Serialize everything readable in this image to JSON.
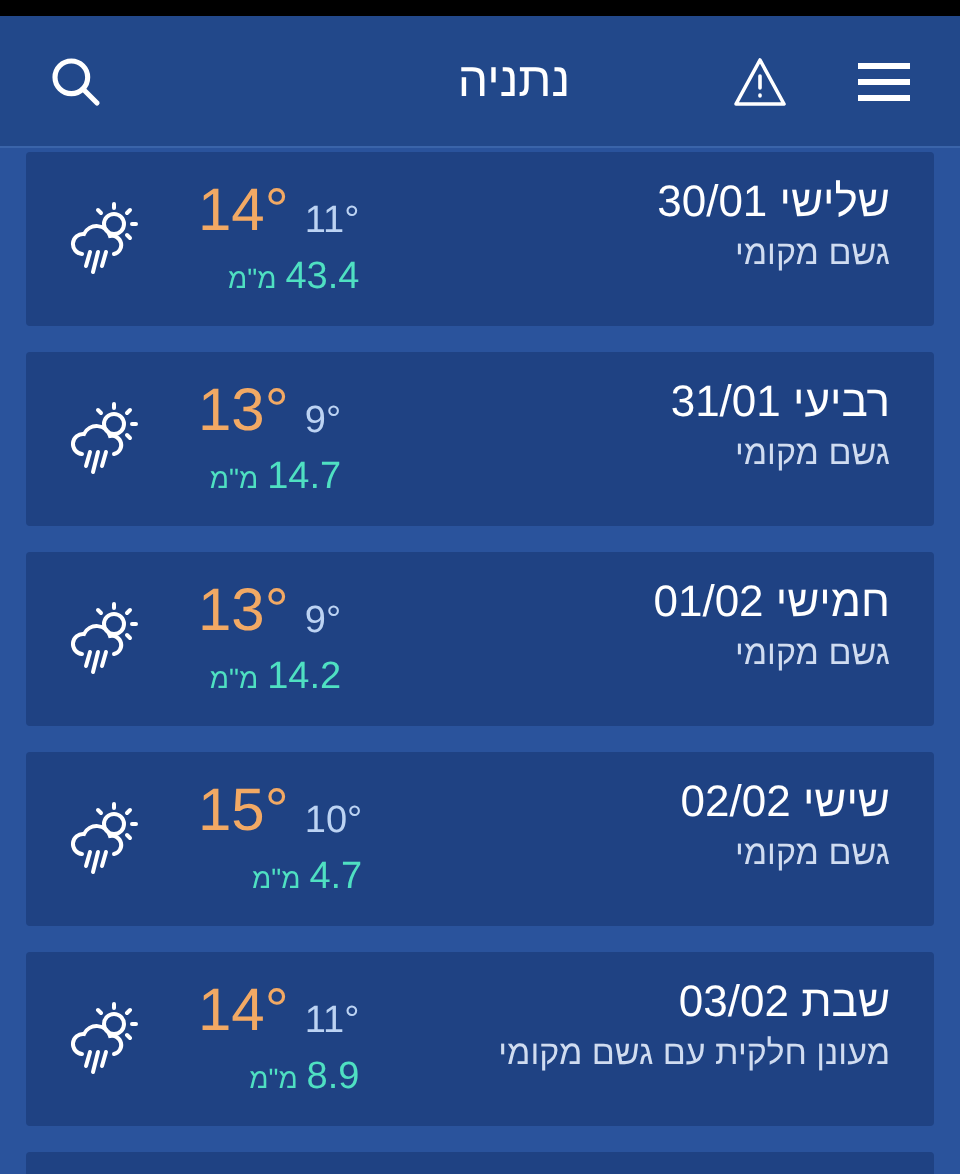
{
  "header": {
    "title": "נתניה"
  },
  "days": [
    {
      "day": "שלישי 30/01",
      "description": "גשם מקומי",
      "high": "14°",
      "low": "11°",
      "rain": "43.4",
      "rain_unit": "מ\"מ"
    },
    {
      "day": "רביעי 31/01",
      "description": "גשם מקומי",
      "high": "13°",
      "low": "9°",
      "rain": "14.7",
      "rain_unit": "מ\"מ"
    },
    {
      "day": "חמישי 01/02",
      "description": "גשם מקומי",
      "high": "13°",
      "low": "9°",
      "rain": "14.2",
      "rain_unit": "מ\"מ"
    },
    {
      "day": "שישי 02/02",
      "description": "גשם מקומי",
      "high": "15°",
      "low": "10°",
      "rain": "4.7",
      "rain_unit": "מ\"מ"
    },
    {
      "day": "שבת 03/02",
      "description": "מעונן חלקית עם גשם מקומי",
      "high": "14°",
      "low": "11°",
      "rain": "8.9",
      "rain_unit": "מ\"מ"
    }
  ]
}
